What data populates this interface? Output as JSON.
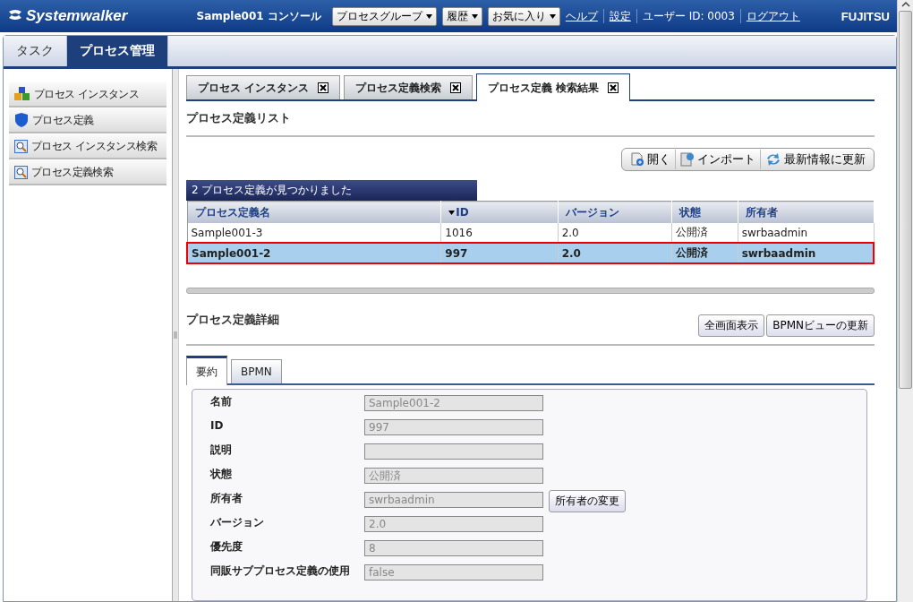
{
  "header": {
    "logo": "Systemwalker",
    "console_title": "Sample001 コンソール",
    "dropdowns": [
      "プロセスグループ",
      "履歴",
      "お気に入り"
    ],
    "links": [
      "ヘルプ",
      "設定"
    ],
    "user": "ユーザー ID: 0003",
    "logout": "ログアウト",
    "brand": "FUJITSU"
  },
  "main_tabs": [
    {
      "label": "タスク",
      "selected": false
    },
    {
      "label": "プロセス管理",
      "selected": true
    }
  ],
  "sidebar": {
    "items": [
      {
        "label": "プロセス インスタンス",
        "kind": "cubes"
      },
      {
        "label": "プロセス定義",
        "kind": "shield"
      },
      {
        "label": "プロセス インスタンス検索",
        "kind": "search"
      },
      {
        "label": "プロセス定義検索",
        "kind": "search"
      }
    ]
  },
  "content_tabs": [
    {
      "label": "プロセス インスタンス",
      "selected": false
    },
    {
      "label": "プロセス定義検索",
      "selected": false
    },
    {
      "label": "プロセス定義 検索結果",
      "selected": true
    }
  ],
  "list": {
    "title": "プロセス定義リスト",
    "toolbar": [
      {
        "label": "開く",
        "kind": "open"
      },
      {
        "label": "インポート",
        "kind": "import"
      },
      {
        "label": "最新情報に更新",
        "kind": "refresh"
      }
    ],
    "caption": "2 プロセス定義が見つかりました",
    "columns": [
      {
        "label": "プロセス定義名",
        "sorted": false
      },
      {
        "label": "ID",
        "sorted": true
      },
      {
        "label": "バージョン",
        "sorted": false
      },
      {
        "label": "状態",
        "sorted": false
      },
      {
        "label": "所有者",
        "sorted": false
      }
    ],
    "rows": [
      {
        "cells": [
          "Sample001-3",
          "1016",
          "2.0",
          "公開済",
          "swrbaadmin"
        ],
        "selected": false
      },
      {
        "cells": [
          "Sample001-2",
          "997",
          "2.0",
          "公開済",
          "swrbaadmin"
        ],
        "selected": true
      }
    ]
  },
  "detail": {
    "title": "プロセス定義詳細",
    "buttons": [
      "全画面表示",
      "BPMNビューの更新"
    ],
    "tabs": [
      {
        "label": "要約",
        "selected": true
      },
      {
        "label": "BPMN",
        "selected": false
      }
    ],
    "fields": [
      {
        "label": "名前",
        "value": "Sample001-2"
      },
      {
        "label": "ID",
        "value": "997"
      },
      {
        "label": "説明"
      },
      {
        "label": "状態",
        "value": "公開済"
      },
      {
        "label": "所有者",
        "value": "swrbaadmin",
        "button": "所有者の変更"
      },
      {
        "label": "バージョン",
        "value": "2.0"
      },
      {
        "label": "優先度",
        "value": "8"
      },
      {
        "label": "同販サブプロセス定義の使用",
        "value": "false"
      }
    ]
  }
}
